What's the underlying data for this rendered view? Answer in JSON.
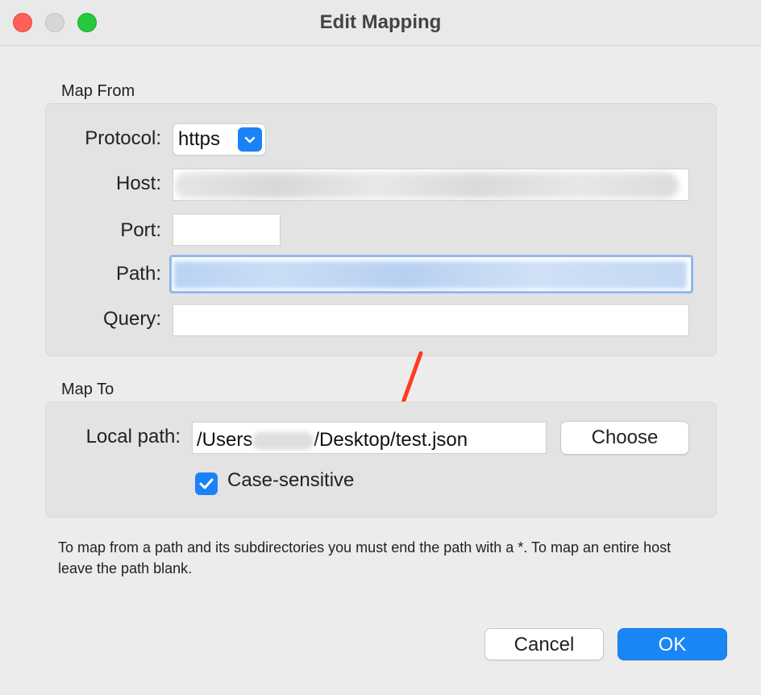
{
  "window": {
    "title": "Edit Mapping"
  },
  "map_from": {
    "section_label": "Map From",
    "protocol": {
      "label": "Protocol:",
      "value": "https",
      "icon": "chevron-down-icon"
    },
    "host": {
      "label": "Host:",
      "value": ""
    },
    "port": {
      "label": "Port:",
      "value": ""
    },
    "path": {
      "label": "Path:",
      "value": ""
    },
    "query": {
      "label": "Query:",
      "value": ""
    }
  },
  "map_to": {
    "section_label": "Map To",
    "local_path": {
      "label": "Local path:",
      "value_prefix": "/Users",
      "value_suffix": "/Desktop/test.json"
    },
    "choose_button": "Choose",
    "case_sensitive": {
      "label": "Case-sensitive",
      "checked": true,
      "icon": "checkmark-icon"
    }
  },
  "help_text": "To map from a path and its subdirectories you must end the path with a *. To map an entire host leave the path blank.",
  "buttons": {
    "cancel": "Cancel",
    "ok": "OK"
  },
  "colors": {
    "accent": "#1a82f7",
    "annotation_arrow": "#ff3b1f"
  }
}
